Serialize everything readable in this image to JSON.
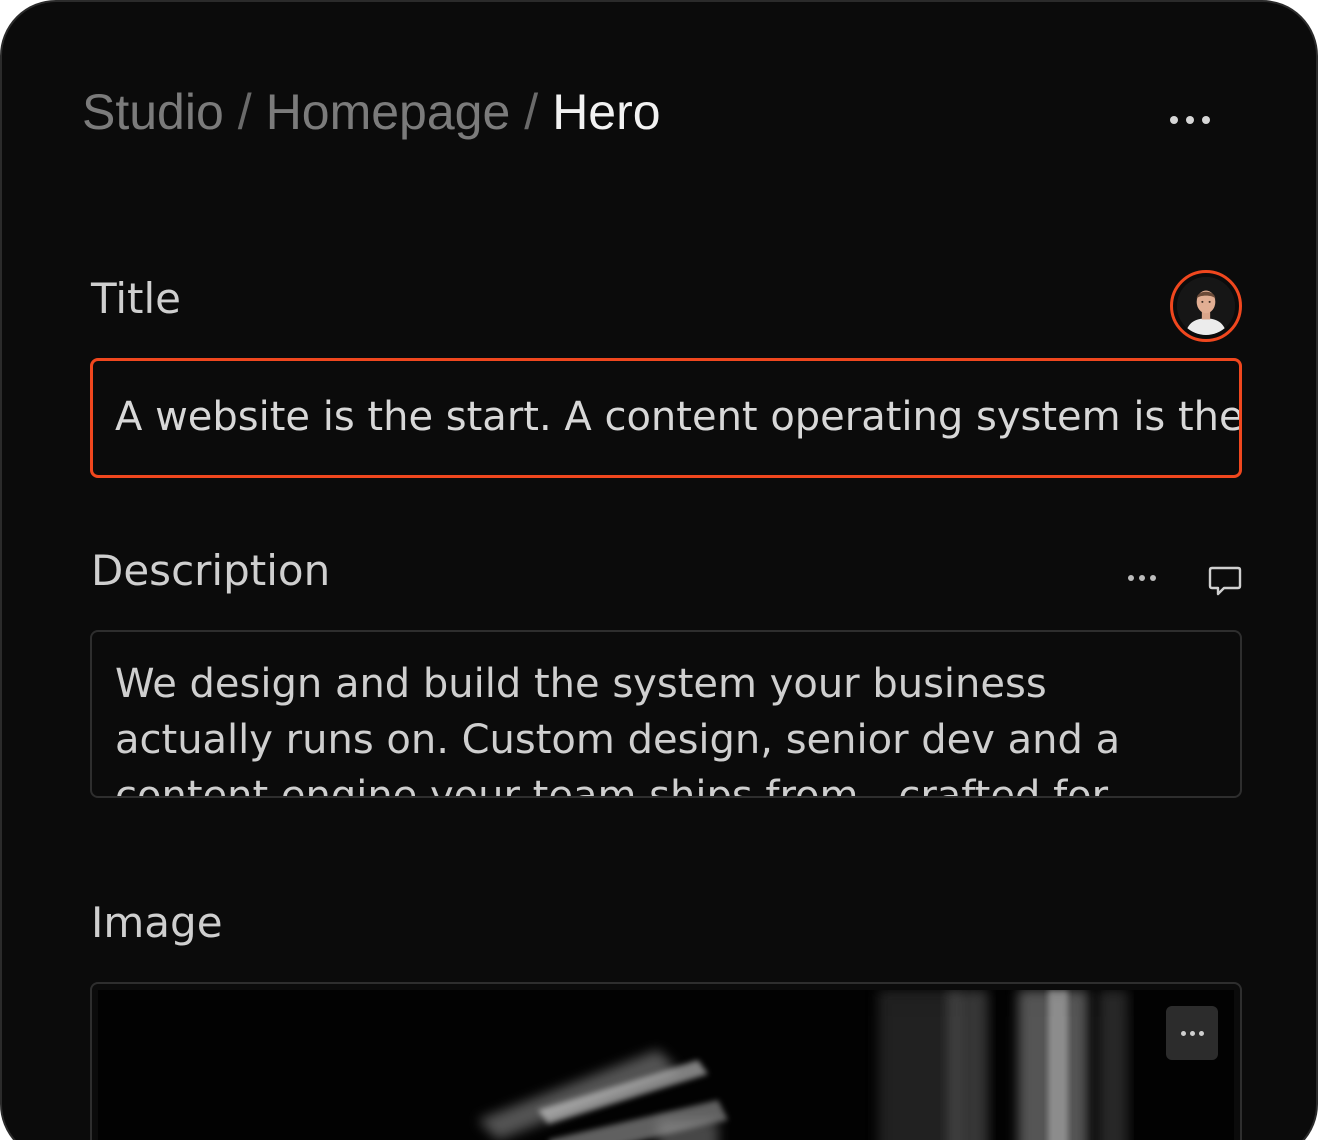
{
  "breadcrumb": {
    "items": [
      "Studio",
      "Homepage"
    ],
    "separator": "/",
    "current": "Hero"
  },
  "icons": {
    "more": "more-horizontal-icon",
    "comment": "comment-icon"
  },
  "fields": {
    "title": {
      "label": "Title",
      "value": "A website is the start. A content operating system is the"
    },
    "description": {
      "label": "Description",
      "value": "We design and build the system your business actually runs on. Custom design, senior dev and a content engine your team ships from - crafted for"
    },
    "image": {
      "label": "Image"
    }
  },
  "colors": {
    "background": "#0b0b0b",
    "accent": "#f0471e",
    "border": "#2e2e2e",
    "text_primary": "#f2f2f2",
    "text_muted": "#7b7b7b"
  }
}
